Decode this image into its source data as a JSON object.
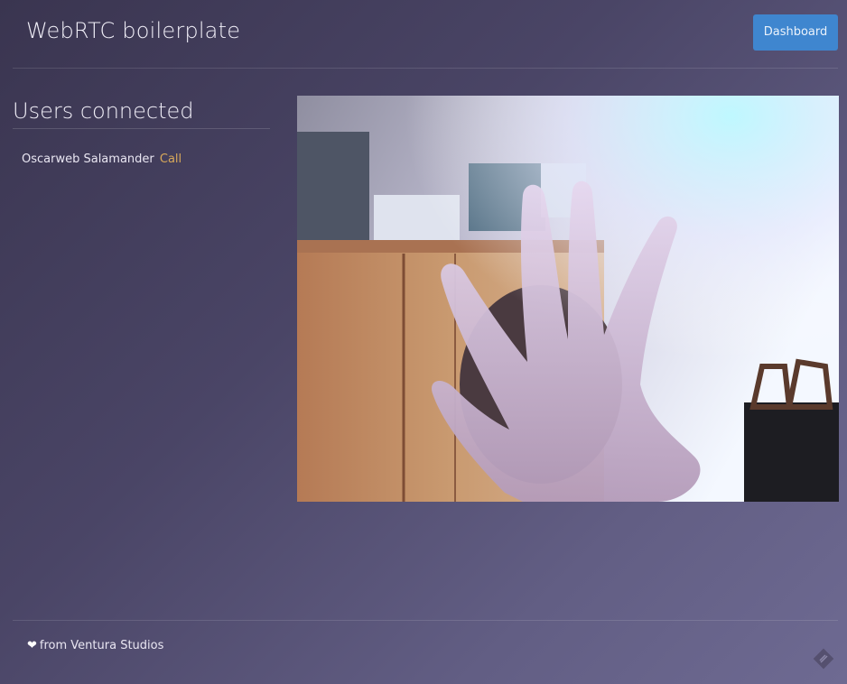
{
  "header": {
    "title": "WebRTC boilerplate",
    "dashboard_label": "Dashboard"
  },
  "sidebar": {
    "heading": "Users connected",
    "users": [
      {
        "name": "Oscarweb Salamander",
        "action": "Call"
      }
    ]
  },
  "footer": {
    "credit_text": "from Ventura Studios"
  },
  "icons": {
    "heart": "heart-icon",
    "corner": "feedback-icon"
  },
  "colors": {
    "accent": "#3f86cf",
    "link": "#d7a85a"
  }
}
